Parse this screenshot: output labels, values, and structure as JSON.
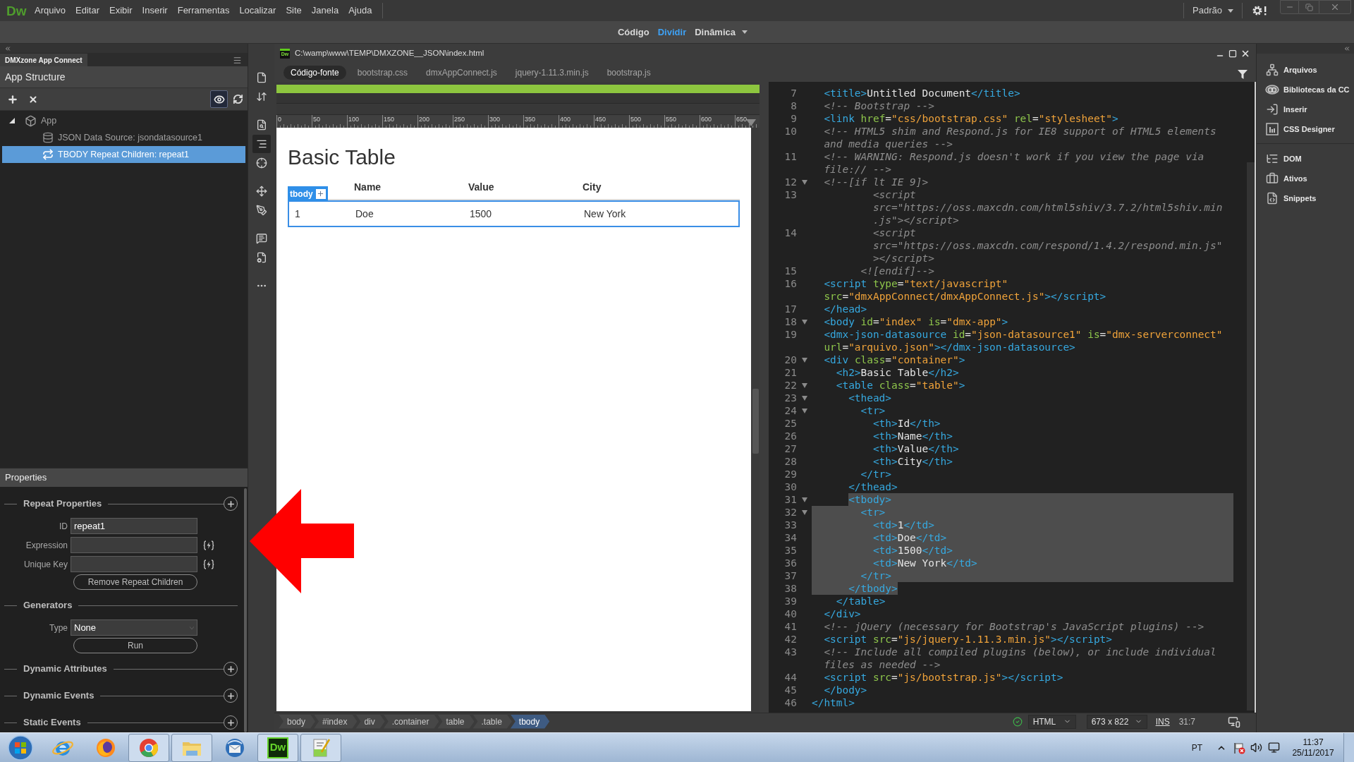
{
  "top_bar": {
    "logo": "Dw",
    "menu": [
      "Arquivo",
      "Editar",
      "Exibir",
      "Inserir",
      "Ferramentas",
      "Localizar",
      "Site",
      "Janela",
      "Ajuda"
    ],
    "workspace": "Padrão"
  },
  "view_modes": [
    {
      "label": "Código",
      "selected": false,
      "menu": false
    },
    {
      "label": "Dividir",
      "selected": true,
      "menu": false
    },
    {
      "label": "Dinâmica",
      "selected": false,
      "menu": true
    }
  ],
  "left_panel": {
    "tab": "DMXzone App Connect",
    "app_structure": {
      "title": "App Structure",
      "preview_on": true,
      "tree": [
        {
          "label": "App",
          "kind": "app",
          "selected": false,
          "expanded": true,
          "children": [
            {
              "label": "JSON Data Source: jsondatasource1",
              "kind": "datasource",
              "selected": false
            },
            {
              "label": "TBODY Repeat Children: repeat1",
              "kind": "repeat",
              "selected": true
            }
          ]
        }
      ]
    },
    "properties": {
      "title": "Properties",
      "sections": [
        {
          "title": "Repeat Properties",
          "addable": true,
          "fields": [
            {
              "kind": "input",
              "label": "ID",
              "value": "repeat1",
              "dynamic": false
            },
            {
              "kind": "input",
              "label": "Expression",
              "dynamic": true
            },
            {
              "kind": "input",
              "label": "Unique Key",
              "dynamic": true
            },
            {
              "kind": "button",
              "label": "Remove Repeat Children"
            }
          ]
        },
        {
          "title": "Generators",
          "addable": false,
          "fields": [
            {
              "kind": "select",
              "label": "Type",
              "value": "None"
            },
            {
              "kind": "button",
              "label": "Run"
            }
          ]
        },
        {
          "title": "Dynamic Attributes",
          "addable": true
        },
        {
          "title": "Dynamic Events",
          "addable": true
        },
        {
          "title": "Static Events",
          "addable": true
        }
      ]
    }
  },
  "doc_toolbar": [
    [
      {
        "kind": "file",
        "selected": false
      },
      {
        "kind": "sort",
        "selected": false
      }
    ],
    [
      {
        "kind": "preview",
        "selected": false
      },
      {
        "kind": "structure",
        "selected": true
      },
      {
        "kind": "target",
        "selected": false
      }
    ],
    [
      {
        "kind": "move",
        "selected": false
      },
      {
        "kind": "pen",
        "selected": false
      }
    ],
    [
      {
        "kind": "comment",
        "selected": false
      },
      {
        "kind": "settings",
        "selected": false
      }
    ],
    [
      {
        "kind": "more",
        "selected": false
      }
    ]
  ],
  "document": {
    "icon_label": "Dw",
    "path": "C:\\wamp\\www\\TEMP\\DMXZONE__JSON\\index.html",
    "files": [
      {
        "label": "Código-fonte",
        "selected": true
      },
      {
        "label": "bootstrap.css",
        "selected": false
      },
      {
        "label": "dmxAppConnect.js",
        "selected": false
      },
      {
        "label": "jquery-1.11.3.min.js",
        "selected": false
      },
      {
        "label": "bootstrap.js",
        "selected": false
      }
    ],
    "design": {
      "ruler": [
        "0",
        "50",
        "100",
        "150",
        "200",
        "250",
        "300",
        "350",
        "400",
        "450",
        "500",
        "550",
        "600",
        "650"
      ],
      "heading": "Basic Table",
      "table": {
        "columns": [
          "",
          "Name",
          "Value",
          "City"
        ],
        "rows": [
          {
            "cells": [
              "1",
              "Doe",
              "1500",
              "New York"
            ],
            "selected": true
          }
        ]
      },
      "selection_badge": "tbody"
    },
    "code": {
      "lines": [
        {
          "number": "7",
          "kind": "code",
          "fold": false,
          "selected": false,
          "rows": [
            "  <title>Untitled Document</title>"
          ]
        },
        {
          "number": "8",
          "kind": "comment",
          "fold": false,
          "selected": false,
          "rows": [
            "  <!-- Bootstrap -->"
          ]
        },
        {
          "number": "9",
          "kind": "code",
          "fold": false,
          "selected": false,
          "rows": [
            "  <link href=\"css/bootstrap.css\" rel=\"stylesheet\">"
          ]
        },
        {
          "number": "10",
          "kind": "comment",
          "fold": false,
          "selected": false,
          "rows": [
            "  <!-- HTML5 shim and Respond.js for IE8 support of HTML5 elements",
            "  and media queries -->"
          ]
        },
        {
          "number": "11",
          "kind": "comment",
          "fold": false,
          "selected": false,
          "rows": [
            "  <!-- WARNING: Respond.js doesn't work if you view the page via",
            "  file:// -->"
          ]
        },
        {
          "number": "12",
          "kind": "comment",
          "fold": true,
          "selected": false,
          "rows": [
            "  <!--[if lt IE 9]>"
          ]
        },
        {
          "number": "13",
          "kind": "comment",
          "fold": false,
          "selected": false,
          "rows": [
            "          <script",
            "          src=\"https://oss.maxcdn.com/html5shiv/3.7.2/html5shiv.min",
            "          .js\"></script>"
          ]
        },
        {
          "number": "14",
          "kind": "comment",
          "fold": false,
          "selected": false,
          "rows": [
            "          <script",
            "          src=\"https://oss.maxcdn.com/respond/1.4.2/respond.min.js\"",
            "          ></script>"
          ]
        },
        {
          "number": "15",
          "kind": "comment",
          "fold": false,
          "selected": false,
          "rows": [
            "        <![endif]-->"
          ]
        },
        {
          "number": "16",
          "kind": "code",
          "fold": false,
          "selected": false,
          "rows": [
            "  <script type=\"text/javascript\"",
            "  src=\"dmxAppConnect/dmxAppConnect.js\"></script>"
          ]
        },
        {
          "number": "17",
          "kind": "code",
          "fold": false,
          "selected": false,
          "rows": [
            "  </head>"
          ]
        },
        {
          "number": "18",
          "kind": "code",
          "fold": true,
          "selected": false,
          "rows": [
            "  <body id=\"index\" is=\"dmx-app\">"
          ]
        },
        {
          "number": "19",
          "kind": "code",
          "fold": false,
          "selected": false,
          "rows": [
            "  <dmx-json-datasource id=\"json-datasource1\" is=\"dmx-serverconnect\"",
            "  url=\"arquivo.json\"></dmx-json-datasource>"
          ]
        },
        {
          "number": "20",
          "kind": "code",
          "fold": true,
          "selected": false,
          "rows": [
            "  <div class=\"container\">"
          ]
        },
        {
          "number": "21",
          "kind": "code",
          "fold": false,
          "selected": false,
          "rows": [
            "    <h2>Basic Table</h2>"
          ]
        },
        {
          "number": "22",
          "kind": "code",
          "fold": true,
          "selected": false,
          "rows": [
            "    <table class=\"table\">"
          ]
        },
        {
          "number": "23",
          "kind": "code",
          "fold": true,
          "selected": false,
          "rows": [
            "      <thead>"
          ]
        },
        {
          "number": "24",
          "kind": "code",
          "fold": true,
          "selected": false,
          "rows": [
            "        <tr>"
          ]
        },
        {
          "number": "25",
          "kind": "code",
          "fold": false,
          "selected": false,
          "rows": [
            "          <th>Id</th>"
          ]
        },
        {
          "number": "26",
          "kind": "code",
          "fold": false,
          "selected": false,
          "rows": [
            "          <th>Name</th>"
          ]
        },
        {
          "number": "27",
          "kind": "code",
          "fold": false,
          "selected": false,
          "rows": [
            "          <th>Value</th>"
          ]
        },
        {
          "number": "28",
          "kind": "code",
          "fold": false,
          "selected": false,
          "rows": [
            "          <th>City</th>"
          ]
        },
        {
          "number": "29",
          "kind": "code",
          "fold": false,
          "selected": false,
          "rows": [
            "        </tr>"
          ]
        },
        {
          "number": "30",
          "kind": "code",
          "fold": false,
          "selected": false,
          "rows": [
            "      </thead>"
          ]
        },
        {
          "number": "31",
          "kind": "code",
          "fold": true,
          "selected": true,
          "rows": [
            "      <tbody>"
          ]
        },
        {
          "number": "32",
          "kind": "code",
          "fold": true,
          "selected": true,
          "rows": [
            "        <tr>"
          ]
        },
        {
          "number": "33",
          "kind": "code",
          "fold": false,
          "selected": true,
          "rows": [
            "          <td>1</td>"
          ]
        },
        {
          "number": "34",
          "kind": "code",
          "fold": false,
          "selected": true,
          "rows": [
            "          <td>Doe</td>"
          ]
        },
        {
          "number": "35",
          "kind": "code",
          "fold": false,
          "selected": true,
          "rows": [
            "          <td>1500</td>"
          ]
        },
        {
          "number": "36",
          "kind": "code",
          "fold": false,
          "selected": true,
          "rows": [
            "          <td>New York</td>"
          ]
        },
        {
          "number": "37",
          "kind": "code",
          "fold": false,
          "selected": true,
          "rows": [
            "        </tr>"
          ]
        },
        {
          "number": "38",
          "kind": "code",
          "fold": false,
          "selected": true,
          "rows": [
            "      </tbody>"
          ]
        },
        {
          "number": "39",
          "kind": "code",
          "fold": false,
          "selected": false,
          "rows": [
            "    </table>"
          ]
        },
        {
          "number": "40",
          "kind": "code",
          "fold": false,
          "selected": false,
          "rows": [
            "  </div>"
          ]
        },
        {
          "number": "41",
          "kind": "comment",
          "fold": false,
          "selected": false,
          "rows": [
            "  <!-- jQuery (necessary for Bootstrap's JavaScript plugins) -->"
          ]
        },
        {
          "number": "42",
          "kind": "code",
          "fold": false,
          "selected": false,
          "rows": [
            "  <script src=\"js/jquery-1.11.3.min.js\"></script>"
          ]
        },
        {
          "number": "43",
          "kind": "comment",
          "fold": false,
          "selected": false,
          "rows": [
            "  <!-- Include all compiled plugins (below), or include individual",
            "  files as needed -->"
          ]
        },
        {
          "number": "44",
          "kind": "code",
          "fold": false,
          "selected": false,
          "rows": [
            "  <script src=\"js/bootstrap.js\"></script>"
          ]
        },
        {
          "number": "45",
          "kind": "code",
          "fold": false,
          "selected": false,
          "rows": [
            "  </body>"
          ]
        },
        {
          "number": "46",
          "kind": "code",
          "fold": false,
          "selected": false,
          "rows": [
            "</html>"
          ]
        }
      ]
    },
    "status_bar": {
      "tag_path": [
        {
          "label": "body",
          "selected": false
        },
        {
          "label": "#index",
          "selected": false
        },
        {
          "label": "div",
          "selected": false
        },
        {
          "label": ".container",
          "selected": false
        },
        {
          "label": "table",
          "selected": false
        },
        {
          "label": ".table",
          "selected": false
        },
        {
          "label": "tbody",
          "selected": true
        }
      ],
      "valid": true,
      "language": "HTML",
      "viewport": "673 x 822",
      "mode": "INS",
      "cursor": "31:7"
    }
  },
  "right_panel": {
    "groups": [
      [
        {
          "label": "Arquivos",
          "kind": "files"
        },
        {
          "label": "Bibliotecas da CC",
          "kind": "libraries"
        },
        {
          "label": "Inserir",
          "kind": "insert"
        },
        {
          "label": "CSS Designer",
          "kind": "css"
        }
      ],
      [
        {
          "label": "DOM",
          "kind": "dom"
        },
        {
          "label": "Ativos",
          "kind": "assets"
        },
        {
          "label": "Snippets",
          "kind": "snippets"
        }
      ]
    ]
  },
  "taskbar": {
    "apps": [
      {
        "kind": "ie",
        "running": false
      },
      {
        "kind": "firefox",
        "running": false
      },
      {
        "kind": "chrome",
        "running": true
      },
      {
        "kind": "explorer",
        "running": true
      },
      {
        "kind": "thunderbird",
        "running": false
      },
      {
        "kind": "dreamweaver",
        "label": "Dw",
        "running": true
      },
      {
        "kind": "notepad",
        "running": true
      }
    ],
    "tray": {
      "language": "PT",
      "time": "11:37",
      "date": "25/11/2017"
    }
  }
}
